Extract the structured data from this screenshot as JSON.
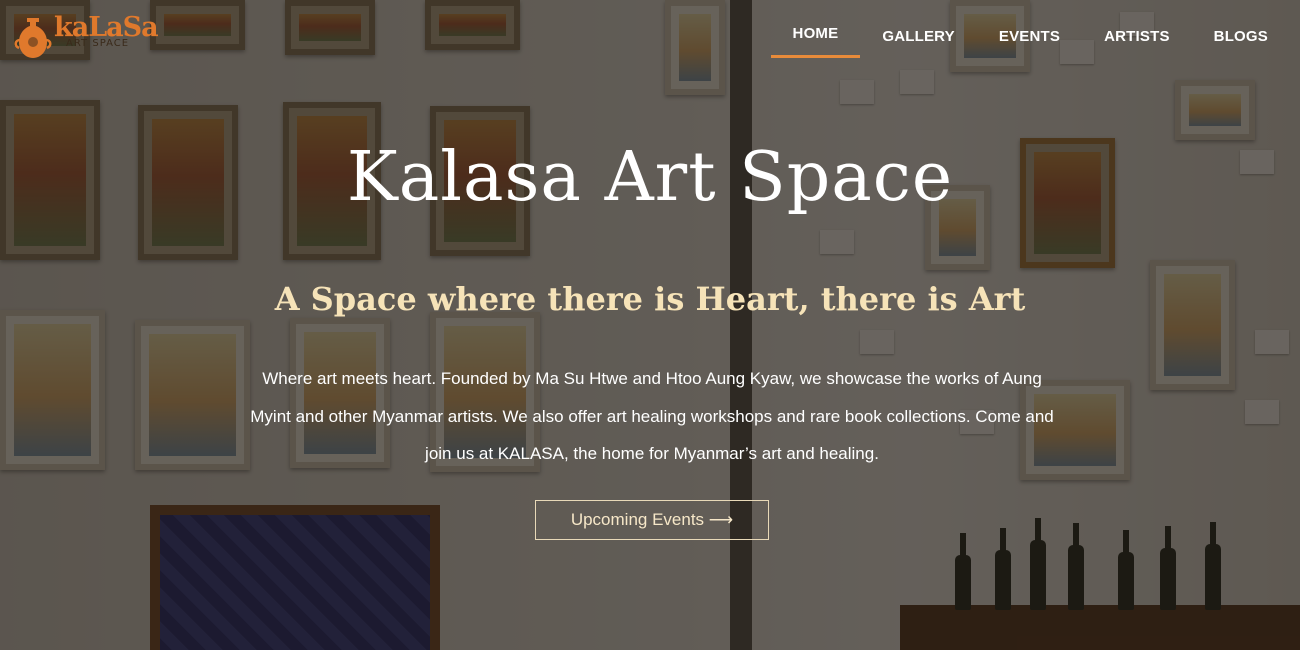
{
  "brand": {
    "name": "kaLaSa",
    "subtitle": "ART SPACE",
    "logo_icon": "vase-icon",
    "accent_color": "#e0792c"
  },
  "nav": {
    "items": [
      {
        "label": "HOME",
        "active": true
      },
      {
        "label": "GALLERY",
        "active": false
      },
      {
        "label": "EVENTS",
        "active": false
      },
      {
        "label": "ARTISTS",
        "active": false
      },
      {
        "label": "BLOGS",
        "active": false
      }
    ],
    "active_underline_color": "#e88b3a"
  },
  "hero": {
    "title": "Kalasa Art Space",
    "subtitle": "A Space where there is Heart, there is Art",
    "description": "Where art meets heart. Founded by Ma Su Htwe and Htoo Aung Kyaw, we showcase the works of Aung Myint and other Myanmar artists. We also offer art healing workshops and rare book collections. Come and join us at KALASA, the home for Myanmar’s art and healing.",
    "cta_label": "Upcoming Events ⟶",
    "subtitle_color": "#f6e3b8"
  }
}
